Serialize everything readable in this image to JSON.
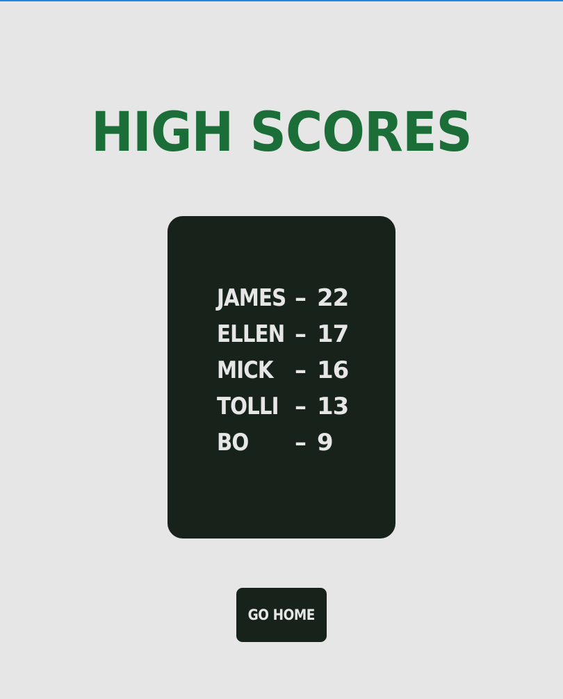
{
  "page": {
    "title": "HIGH SCORES"
  },
  "scores": [
    {
      "name": "JAMES",
      "separator": "–",
      "score": "22"
    },
    {
      "name": "ELLEN",
      "separator": "–",
      "score": "17"
    },
    {
      "name": "MICK",
      "separator": "–",
      "score": "16"
    },
    {
      "name": "TOLLI",
      "separator": "–",
      "score": "13"
    },
    {
      "name": "BO",
      "separator": "–",
      "score": "9"
    }
  ],
  "actions": {
    "home_label": "GO HOME"
  },
  "colors": {
    "background": "#e6e6e6",
    "title": "#1b6e37",
    "panel": "#16221a",
    "panel_text": "#e6e6e6",
    "top_line": "#1e88e5"
  }
}
